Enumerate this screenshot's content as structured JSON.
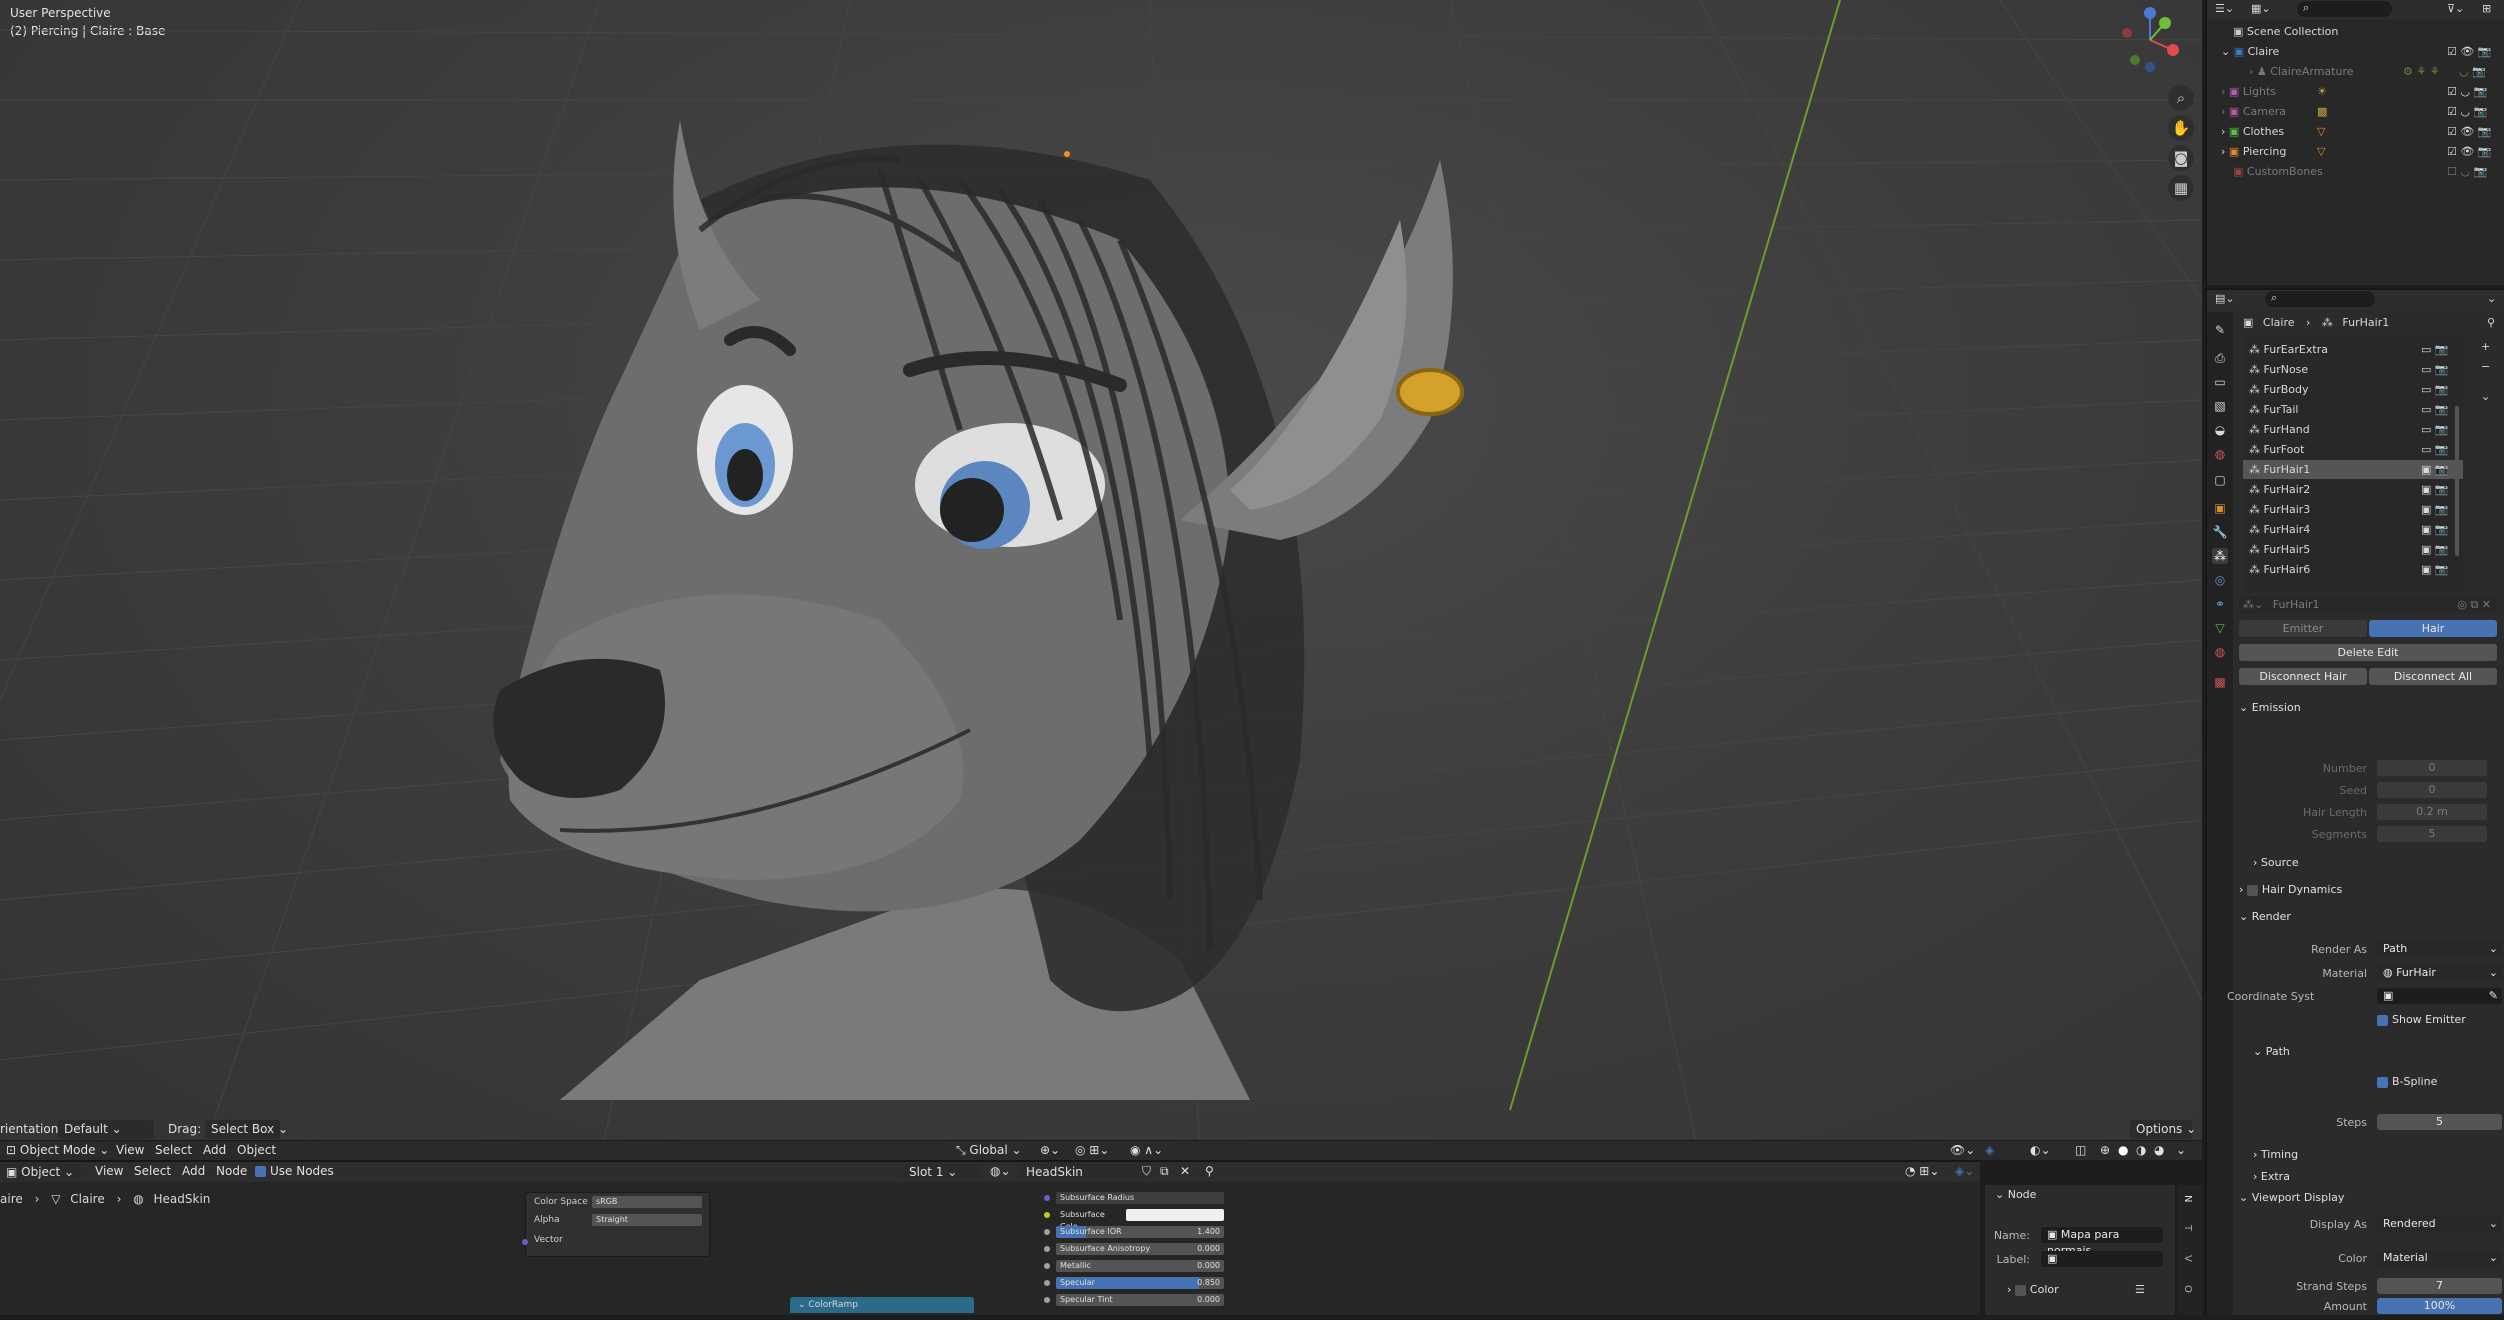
{
  "viewport": {
    "perspective_label": "User Perspective",
    "object_label": "(2) Piercing | Claire : Base",
    "header": {
      "orientation_label": "rientation:",
      "orientation_value": "Default",
      "drag_label": "Drag:",
      "drag_value": "Select Box",
      "options_label": "Options"
    },
    "header2": {
      "mode": "Object Mode",
      "menu": [
        "View",
        "Select",
        "Add",
        "Object"
      ],
      "transform": "Global"
    }
  },
  "node_editor": {
    "header": {
      "editor_type": "Object",
      "menu": [
        "View",
        "Select",
        "Add",
        "Node"
      ],
      "use_nodes_label": "Use Nodes",
      "slot": "Slot 1",
      "material": "HeadSkin"
    },
    "breadcrumb": [
      "aire",
      "Claire",
      "HeadSkin"
    ],
    "image_node": {
      "color_space_label": "Color Space",
      "color_space_value": "sRGB",
      "alpha_label": "Alpha",
      "alpha_value": "Straight",
      "vector_label": "Vector"
    },
    "bsdf_node": {
      "rows": [
        {
          "label": "Subsurface Radius",
          "value": ""
        },
        {
          "label": "Subsurface Colo",
          "value": ""
        },
        {
          "label": "Subsurface IOR",
          "value": "1.400"
        },
        {
          "label": "Subsurface Anisotropy",
          "value": "0.000"
        },
        {
          "label": "Metallic",
          "value": "0.000"
        },
        {
          "label": "Specular",
          "value": "0.850"
        },
        {
          "label": "Specular Tint",
          "value": "0.000"
        }
      ]
    },
    "colorramp_label": "ColorRamp",
    "sidebar": {
      "section": "Node",
      "name_label": "Name:",
      "name_value": "Mapa para normais",
      "label_label": "Label:",
      "color_section": "Color"
    }
  },
  "outliner": {
    "root": "Scene Collection",
    "items": [
      {
        "name": "Claire",
        "level": 1,
        "dim": false
      },
      {
        "name": "ClaireArmature",
        "level": 2,
        "dim": true
      },
      {
        "name": "Lights",
        "level": 1,
        "dim": true
      },
      {
        "name": "Camera",
        "level": 1,
        "dim": true
      },
      {
        "name": "Clothes",
        "level": 1,
        "dim": false
      },
      {
        "name": "Piercing",
        "level": 1,
        "dim": false
      },
      {
        "name": "CustomBones",
        "level": 1,
        "dim": true
      }
    ]
  },
  "properties": {
    "breadcrumb": [
      "Claire",
      "FurHair1"
    ],
    "particle_systems": [
      "FurEarExtra",
      "FurNose",
      "FurBody",
      "FurTail",
      "FurHand",
      "FurFoot",
      "FurHair1",
      "FurHair2",
      "FurHair3",
      "FurHair4",
      "FurHair5",
      "FurHair6"
    ],
    "selected_system": "FurHair1",
    "settings_name": "FurHair1",
    "type_tabs": [
      "Emitter",
      "Hair"
    ],
    "delete_edit": "Delete Edit",
    "disconnect_hair": "Disconnect Hair",
    "disconnect_all": "Disconnect All",
    "emission": {
      "title": "Emission",
      "number_label": "Number",
      "number_value": "0",
      "seed_label": "Seed",
      "seed_value": "0",
      "hair_length_label": "Hair Length",
      "hair_length_value": "0.2 m",
      "segments_label": "Segments",
      "segments_value": "5"
    },
    "source_label": "Source",
    "hair_dynamics_label": "Hair Dynamics",
    "render": {
      "title": "Render",
      "render_as_label": "Render As",
      "render_as_value": "Path",
      "material_label": "Material",
      "material_value": "FurHair",
      "coord_label": "Coordinate Syst",
      "show_emitter_label": "Show Emitter"
    },
    "path": {
      "title": "Path",
      "bspline_label": "B-Spline",
      "steps_label": "Steps",
      "steps_value": "5"
    },
    "timing_label": "Timing",
    "extra_label": "Extra",
    "viewport_display": {
      "title": "Viewport Display",
      "display_as_label": "Display As",
      "display_as_value": "Rendered",
      "color_label": "Color",
      "color_value": "Material",
      "strand_steps_label": "Strand Steps",
      "strand_steps_value": "7",
      "amount_label": "Amount",
      "amount_value": "100%"
    }
  },
  "colors": {
    "accent_blue": "#4772b3",
    "earring_gold": "#d4a12a",
    "axis_green": "#6f9a2e",
    "panel_bg": "#2b2b2b"
  }
}
